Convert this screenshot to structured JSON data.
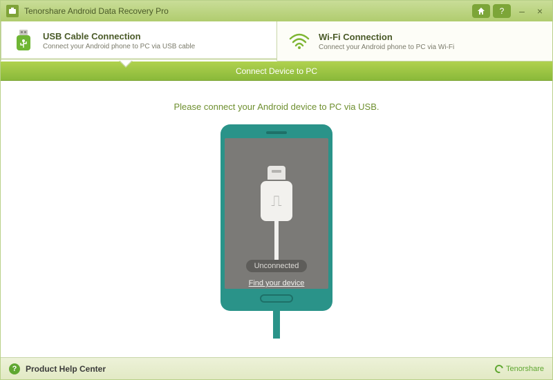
{
  "titlebar": {
    "title": "Tenorshare Android Data Recovery Pro"
  },
  "tabs": {
    "usb": {
      "title": "USB Cable Connection",
      "subtitle": "Connect your Android phone to PC via USB cable"
    },
    "wifi": {
      "title": "Wi-Fi Connection",
      "subtitle": "Connect your Android phone to PC via Wi-Fi"
    }
  },
  "stepbar": {
    "label": "Connect Device to PC"
  },
  "main": {
    "instruction": "Please connect your Android device to PC via USB.",
    "status": "Unconnected",
    "find_link": "Find your device"
  },
  "footer": {
    "help": "Product Help Center",
    "brand": "Tenorshare"
  }
}
